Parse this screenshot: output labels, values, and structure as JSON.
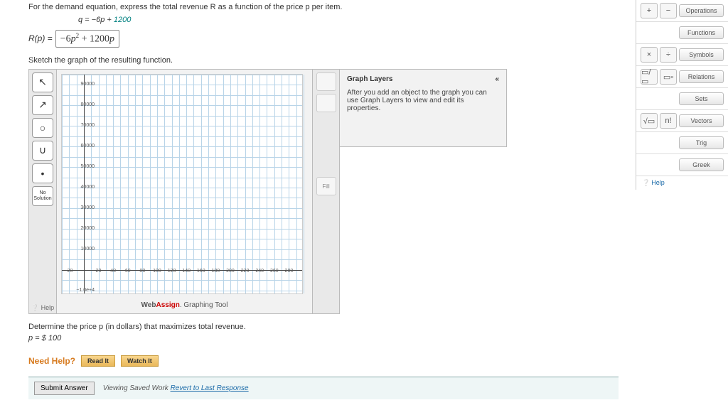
{
  "prompt1": "For the demand equation, express the total revenue R as a function of the price p per item.",
  "demand_eq": {
    "lhs": "q = ",
    "mid": "−6p + ",
    "const": "1200"
  },
  "rp_label": "R(p) = ",
  "rp_answer": "−6p² + 1200p",
  "sketch_label": "Sketch the graph of the resulting function.",
  "tools": {
    "pointer": "↖",
    "line": "↗",
    "circle": "○",
    "parabola": "∪",
    "point": "•",
    "nosol_line1": "No",
    "nosol_line2": "Solution",
    "help": "❔ Help"
  },
  "right_tools": {
    "t1": "",
    "t2": "",
    "fill": "Fill"
  },
  "chart_footer": {
    "web": "Web",
    "assign": "Assign",
    "rest": ". Graphing Tool"
  },
  "layers": {
    "title": "Graph Layers",
    "collapse": "«",
    "desc": "After you add an object to the graph you can use Graph Layers to view and edit its properties."
  },
  "determine": "Determine the price p (in dollars) that maximizes total revenue.",
  "price": {
    "label": "p = $",
    "value": "100"
  },
  "needhelp": "Need Help?",
  "readit": "Read It",
  "watchit": "Watch It",
  "submit": "Submit Answer",
  "saved_prefix": "Viewing Saved Work ",
  "revert": "Revert to Last Response",
  "rcats": [
    "Operations",
    "Functions",
    "Symbols",
    "Relations",
    "Sets",
    "Vectors",
    "Trig",
    "Greek"
  ],
  "rbtns": {
    "plus": "+",
    "minus": "−",
    "times": "×",
    "div": "÷",
    "frac": "▭/▭",
    "exp": "▭▫",
    "sqrt": "√▭",
    "fact": "n!"
  },
  "rhelp": "Help",
  "chart_data": {
    "type": "grid",
    "title": "",
    "xlabel": "",
    "ylabel": "",
    "x_ticks": [
      -20,
      20,
      40,
      60,
      80,
      100,
      120,
      140,
      160,
      180,
      200,
      220,
      240,
      260,
      280
    ],
    "y_ticks": [
      10000,
      20000,
      30000,
      40000,
      50000,
      60000,
      70000,
      80000,
      90000
    ],
    "neg_y_tick": "−1.0e+4",
    "xlim": [
      -30,
      300
    ],
    "ylim": [
      -12000,
      95000
    ],
    "series": []
  }
}
